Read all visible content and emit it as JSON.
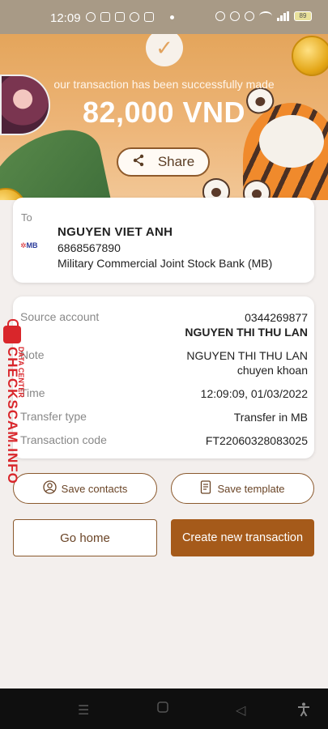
{
  "status_bar": {
    "time": "12:09",
    "battery": "89",
    "icons_left": [
      "messenger-icon",
      "zalo-icon",
      "qr-icon",
      "tiktok-icon",
      "app-icon"
    ],
    "icons_right": [
      "alarm-icon",
      "bell-off-icon",
      "settings-icon",
      "wifi-icon",
      "signal-icon",
      "battery-icon"
    ]
  },
  "hero": {
    "success_message": "our transaction has been successfully made",
    "amount": "82,000 VND",
    "share_label": "Share"
  },
  "recipient": {
    "label": "To",
    "bank_logo": "MB",
    "name": "NGUYEN VIET ANH",
    "account": "6868567890",
    "bank": "Military Commercial Joint Stock Bank (MB)"
  },
  "details": {
    "source_account_label": "Source account",
    "source_account_number": "0344269877",
    "source_account_name": "NGUYEN THI THU LAN",
    "note_label": "Note",
    "note_line1": "NGUYEN THI THU LAN",
    "note_line2": "chuyen khoan",
    "time_label": "Time",
    "time_value": "12:09:09, 01/03/2022",
    "transfer_type_label": "Transfer type",
    "transfer_type_value": "Transfer in MB",
    "transaction_code_label": "Transaction code",
    "transaction_code_value": "FT22060328083025"
  },
  "watermark": {
    "main": "CHECKSCAM.INFO",
    "sub": "DATA CENTER"
  },
  "actions": {
    "save_contacts": "Save contacts",
    "save_template": "Save template",
    "go_home": "Go home",
    "create_new": "Create new transaction"
  },
  "colors": {
    "accent": "#a55a1a",
    "outline": "#8b5a2e",
    "hero": "#e4a55b",
    "watermark": "#d9262b"
  }
}
